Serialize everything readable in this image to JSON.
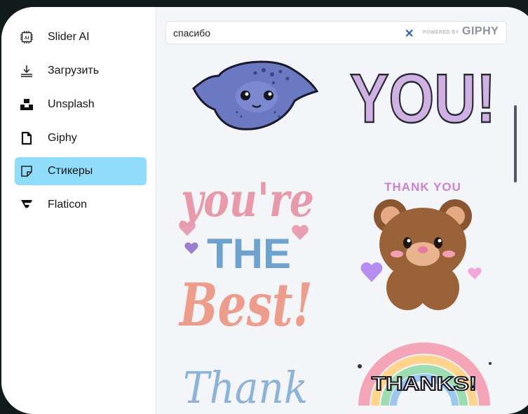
{
  "sidebar": {
    "items": [
      {
        "label": "Slider AI",
        "icon": "ai-chip-icon",
        "active": false
      },
      {
        "label": "Загрузить",
        "icon": "upload-icon",
        "active": false
      },
      {
        "label": "Unsplash",
        "icon": "unsplash-icon",
        "active": false
      },
      {
        "label": "Giphy",
        "icon": "giphy-icon",
        "active": false
      },
      {
        "label": "Стикеры",
        "icon": "sticker-icon",
        "active": true
      },
      {
        "label": "Flaticon",
        "icon": "flaticon-icon",
        "active": false
      }
    ]
  },
  "search": {
    "value": "спасибо",
    "powered_by": "POWERED BY",
    "brand": "GIPHY"
  },
  "stickers": {
    "you_text": "YOU!",
    "best_line1": "you're",
    "best_line2": "THE",
    "best_line3": "Best!",
    "bear_caption": "THANK YOU",
    "thank_text": "Thank",
    "thanks_text": "THANKS!"
  },
  "colors": {
    "active_bg": "#8fdcfb",
    "background": "#0f1c1b",
    "content_bg": "#f4f5f8"
  }
}
